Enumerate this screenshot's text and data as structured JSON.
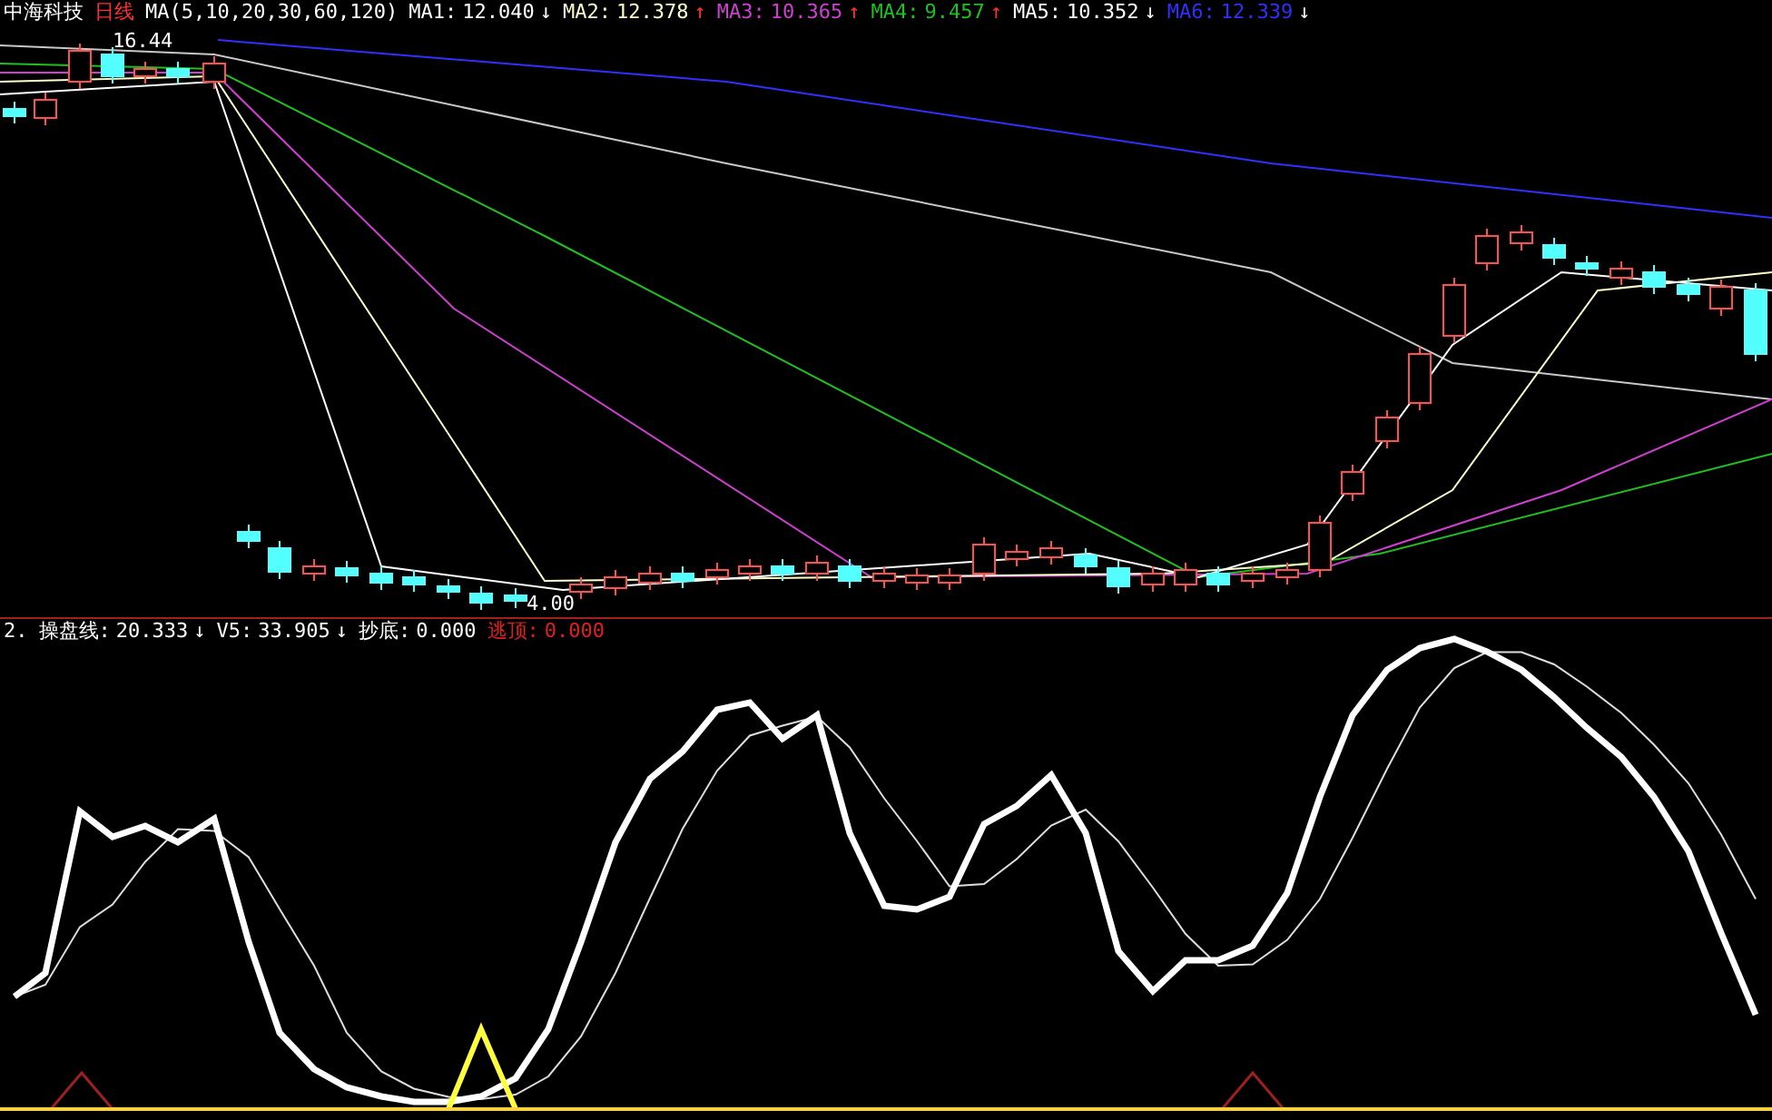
{
  "main_panel": {
    "stock_name": "中海科技",
    "period": "日线",
    "ma_params": "MA(5,10,20,30,60,120)",
    "indicators": [
      {
        "label": "MA1:",
        "value": "12.040",
        "trend": "↓",
        "color": "#ffffff"
      },
      {
        "label": "MA2:",
        "value": "12.378",
        "trend": "↑",
        "color": "#ffffcc"
      },
      {
        "label": "MA3:",
        "value": "10.365",
        "trend": "↑",
        "color": "#d040d0"
      },
      {
        "label": "MA4:",
        "value": "9.457",
        "trend": "↑",
        "color": "#20c020"
      },
      {
        "label": "MA5:",
        "value": "10.352",
        "trend": "↓",
        "color": "#ffffff"
      },
      {
        "label": "MA6:",
        "value": "12.339",
        "trend": "↓",
        "color": "#3030ff"
      }
    ],
    "high_label": "16.44",
    "low_label": "4.00"
  },
  "sub_panel": {
    "index": "2.",
    "indicators": [
      {
        "label": "操盘线:",
        "value": "20.333",
        "trend": "↓",
        "color": "#ffffff"
      },
      {
        "label": "V5:",
        "value": "33.905",
        "trend": "↓",
        "color": "#ffffff"
      },
      {
        "label": "抄底:",
        "value": "0.000",
        "color": "#ffffff"
      },
      {
        "label": "逃顶:",
        "value": "0.000",
        "color": "#e02020"
      }
    ]
  }
}
